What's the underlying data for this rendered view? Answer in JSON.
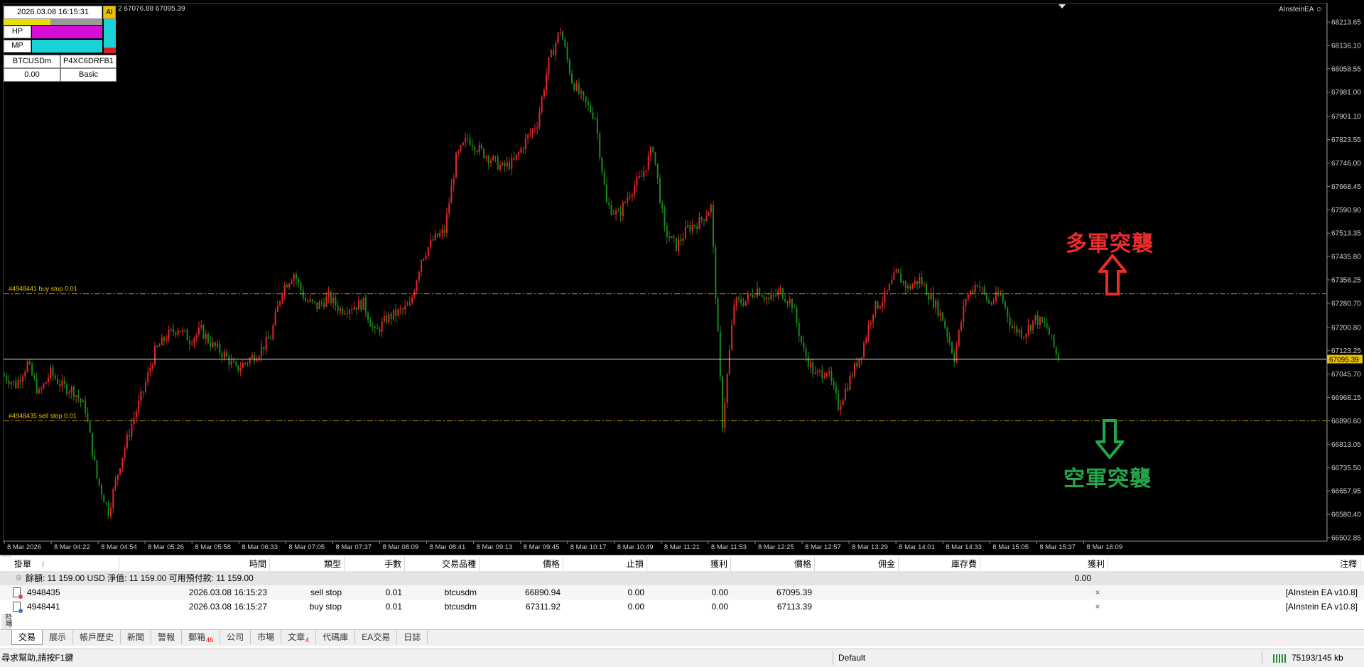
{
  "colors": {
    "bull": "#e3262a",
    "bear": "#1a8a1a",
    "axis_text": "#d0d0d0",
    "order_line": "#c8a000",
    "label_yellow": "#e8c000",
    "up_color": "#ee2a2a",
    "down_color": "#22a84a",
    "hp_bar": "#d50fd5",
    "mp_bar": "#18d2d8"
  },
  "hud": {
    "datetime": "2026.03.08 16:15:31",
    "hp_label": "HP",
    "mp_label": "MP",
    "symbol": "BTCUSDm",
    "account_code": "P4XC6DRFB1",
    "value": "0.00",
    "mode": "Basic",
    "tag": "AI"
  },
  "chart": {
    "header_quote": "2 67076.88 67095.39",
    "ea_label": "AInsteinEA",
    "price_ticks": [
      "68213.65",
      "68136.10",
      "68058.55",
      "67981.00",
      "67901.10",
      "67823.55",
      "67746.00",
      "67668.45",
      "67590.90",
      "67513.35",
      "67435.80",
      "67358.25",
      "67280.70",
      "67200.80",
      "67123.25",
      "67045.70",
      "66968.15",
      "66890.60",
      "66813.05",
      "66735.50",
      "66657.95",
      "66580.40",
      "66502.85"
    ],
    "price_range": [
      66502.85,
      68213.65
    ],
    "current_price": "67095.39",
    "orders": [
      {
        "label": "#4948441 buy stop 0.01",
        "price": 67311.92
      },
      {
        "label": "#4948435 sell stop 0.01",
        "price": 66890.94
      }
    ],
    "time_labels": [
      "8 Mar 2026",
      "8 Mar 04:22",
      "8 Mar 04:54",
      "8 Mar 05:26",
      "8 Mar 05:58",
      "8 Mar 06:33",
      "8 Mar 07:05",
      "8 Mar 07:37",
      "8 Mar 08:09",
      "8 Mar 08:41",
      "8 Mar 09:13",
      "8 Mar 09:45",
      "8 Mar 10:17",
      "8 Mar 10:49",
      "8 Mar 11:21",
      "8 Mar 11:53",
      "8 Mar 12:25",
      "8 Mar 12:57",
      "8 Mar 13:29",
      "8 Mar 14:01",
      "8 Mar 14:33",
      "8 Mar 15:05",
      "8 Mar 15:37",
      "8 Mar 16:09"
    ],
    "up_label": "多軍突襲",
    "down_label": "空軍突襲",
    "closes": [
      67040,
      67010,
      67080,
      66980,
      67050,
      67005,
      66990,
      66930,
      66700,
      66590,
      66750,
      66880,
      66990,
      67120,
      67170,
      67200,
      67160,
      67190,
      67140,
      67110,
      67060,
      67090,
      67120,
      67170,
      67330,
      67380,
      67290,
      67270,
      67300,
      67260,
      67270,
      67280,
      67180,
      67230,
      67250,
      67270,
      67430,
      67490,
      67520,
      67760,
      67830,
      67790,
      67760,
      67730,
      67750,
      67820,
      67880,
      68080,
      68190,
      68020,
      67950,
      67900,
      67610,
      67570,
      67650,
      67700,
      67800,
      67520,
      67470,
      67530,
      67550,
      67600,
      66880,
      67280,
      67290,
      67330,
      67290,
      67320,
      67280,
      67120,
      67040,
      67060,
      66940,
      67030,
      67120,
      67260,
      67300,
      67380,
      67330,
      67360,
      67300,
      67230,
      67100,
      67300,
      67350,
      67280,
      67310,
      67200,
      67180,
      67230,
      67200,
      67090
    ]
  },
  "terminal": {
    "headers": [
      "掛單",
      "時間",
      "類型",
      "手數",
      "交易品種",
      "價格",
      "止損",
      "獲利",
      "價格",
      "佣金",
      "庫存費",
      "獲利",
      "注釋"
    ],
    "sort_mark": "/",
    "balance_text": "餘額: 11 159.00 USD  淨值: 11 159.00  可用預付款: 11 159.00",
    "balance_profit": "0.00",
    "rows": [
      {
        "ticket": "4948435",
        "time": "2026.03.08 16:15:23",
        "type": "sell stop",
        "lots": "0.01",
        "symbol": "btcusdm",
        "price": "66890.94",
        "sl": "0.00",
        "tp": "0.00",
        "cur_price": "67095.39",
        "comment": "[AInstein EA v10.8]"
      },
      {
        "ticket": "4948441",
        "time": "2026.03.08 16:15:27",
        "type": "buy stop",
        "lots": "0.01",
        "symbol": "btcusdm",
        "price": "67311.92",
        "sl": "0.00",
        "tp": "0.00",
        "cur_price": "67113.39",
        "comment": "[AInstein EA v10.8]"
      }
    ],
    "tabs": [
      {
        "label": "交易",
        "badge": ""
      },
      {
        "label": "展示",
        "badge": ""
      },
      {
        "label": "帳戶歷史",
        "badge": ""
      },
      {
        "label": "新聞",
        "badge": ""
      },
      {
        "label": "警報",
        "badge": ""
      },
      {
        "label": "郵箱",
        "badge": "46"
      },
      {
        "label": "公司",
        "badge": ""
      },
      {
        "label": "市場",
        "badge": ""
      },
      {
        "label": "文章",
        "badge": "4"
      },
      {
        "label": "代碼庫",
        "badge": ""
      },
      {
        "label": "EA交易",
        "badge": ""
      },
      {
        "label": "日誌",
        "badge": ""
      }
    ],
    "side_label": "終端"
  },
  "status": {
    "help": "尋求幫助,請按F1鍵",
    "profile": "Default",
    "traffic": "75193/145 kb"
  }
}
